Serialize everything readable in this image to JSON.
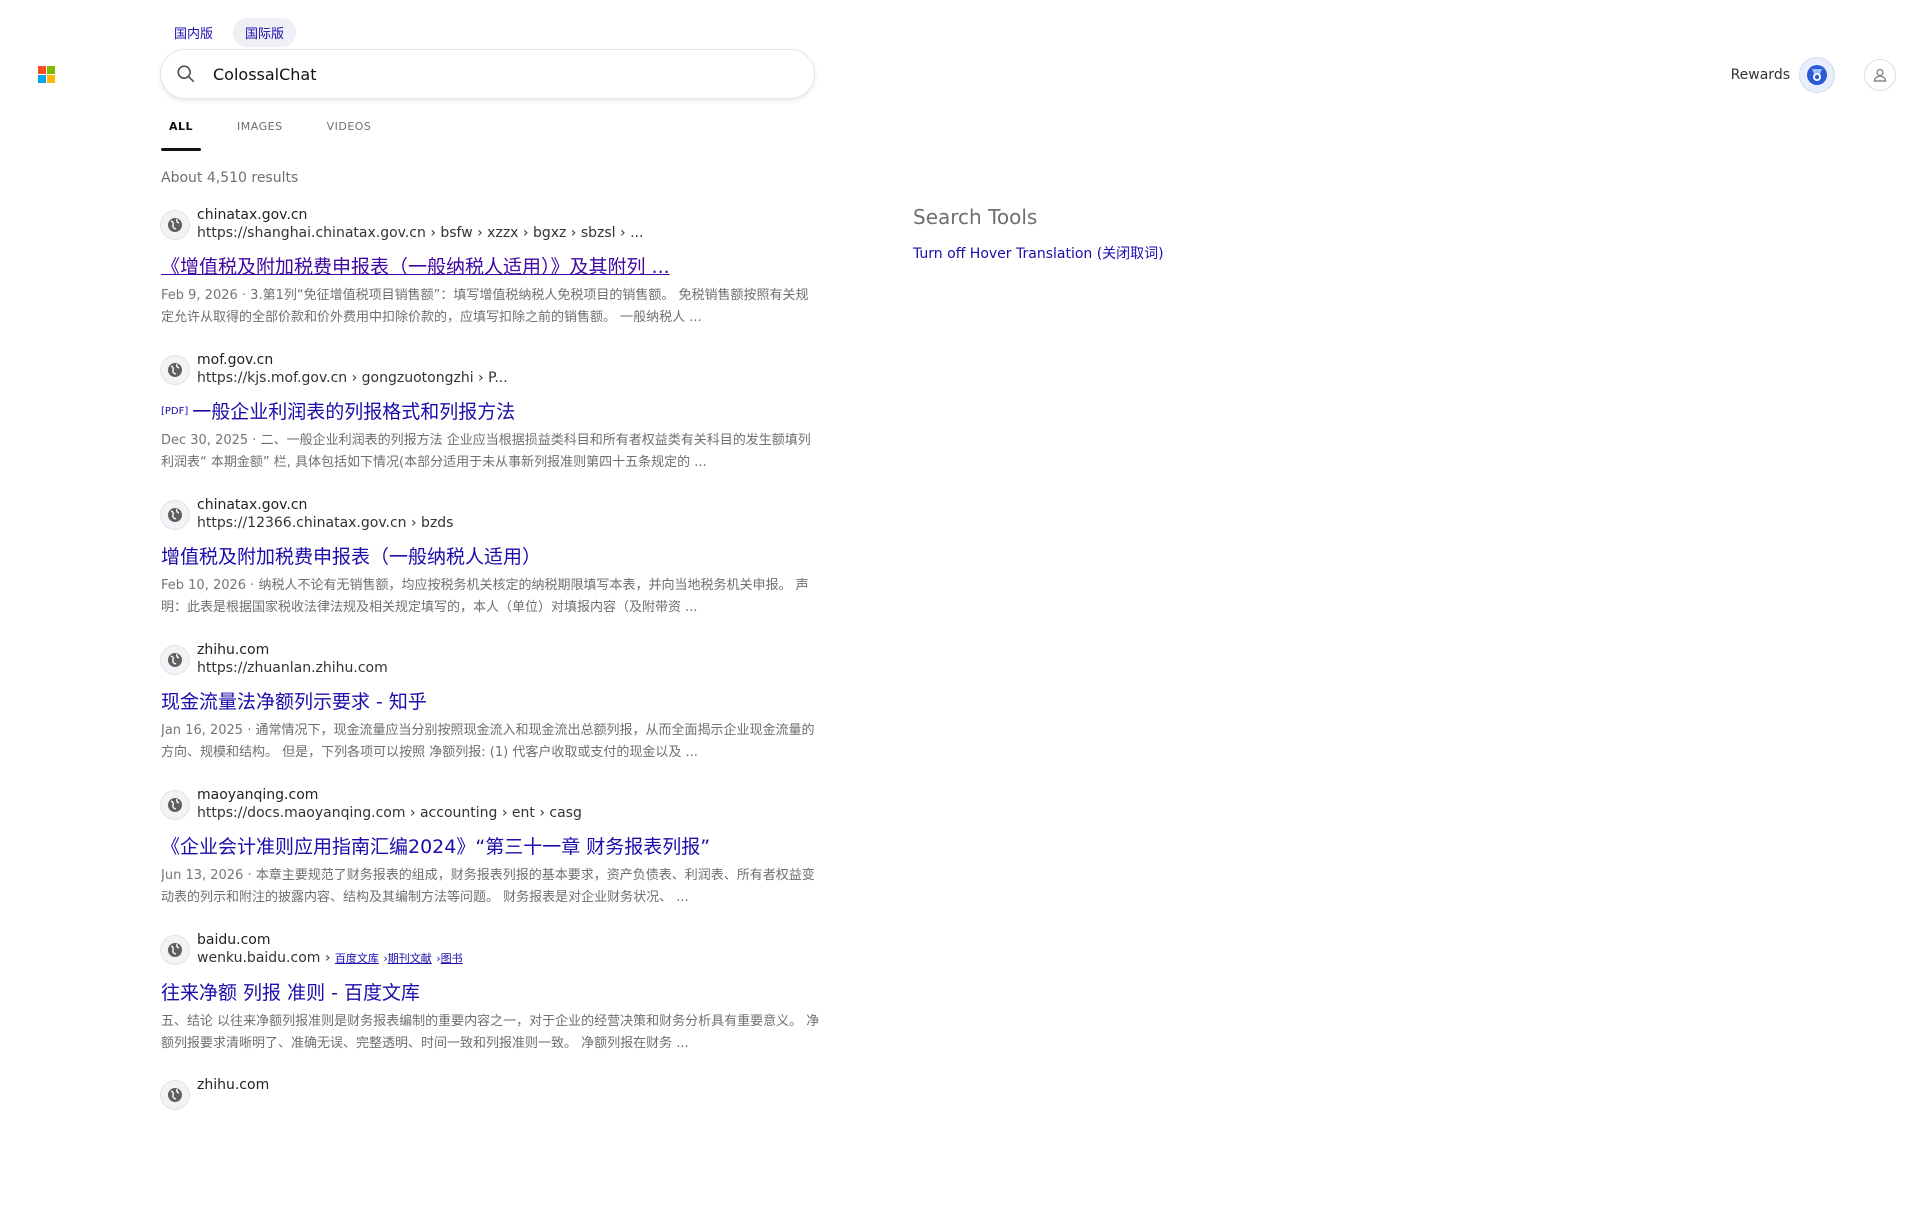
{
  "market_tabs": [
    "国内版",
    "国际版"
  ],
  "search": {
    "query": "ColossalChat"
  },
  "header": {
    "rewards_label": "Rewards"
  },
  "scope_tabs": [
    "ALL",
    "IMAGES",
    "VIDEOS"
  ],
  "result_count": "About 4,510 results",
  "sidebar": {
    "title": "Search Tools",
    "link": "Turn off Hover Translation (关闭取词)"
  },
  "results": [
    {
      "site": "chinatax.gov.cn",
      "url": "https://shanghai.chinatax.gov.cn › bsfw › xzzx › bgxz › sbzsl › ...",
      "title": "《增值税及附加税费申报表（一般纳税人适用）》及其附列 ...",
      "date": "Feb 9, 2026 · ",
      "snippet": "3.第1列“免征增值税项目销售额”：填写增值税纳税人免税项目的销售额。 免税销售额按照有关规定允许从取得的全部价款和价外费用中扣除价款的，应填写扣除之前的销售额。 一般纳税人 ..."
    },
    {
      "site": "mof.gov.cn",
      "url": "https://kjs.mof.gov.cn › gongzuotongzhi › P...",
      "pdf": "[PDF]",
      "title": "一般企业利润表的列报格式和列报方法",
      "date": "Dec 30, 2025 · ",
      "snippet": "二、一般企业利润表的列报方法 企业应当根据损益类科目和所有者权益类有关科目的发生额填列利润表“ 本期金额” 栏, 具体包括如下情况(本部分适用于未从事新列报准则第四十五条规定的 ..."
    },
    {
      "site": "chinatax.gov.cn",
      "url": "https://12366.chinatax.gov.cn › bzds",
      "title": "增值税及附加税费申报表（一般纳税人适用）",
      "date": "Feb 10, 2026 · ",
      "snippet": "纳税人不论有无销售额，均应按税务机关核定的纳税期限填写本表，并向当地税务机关申报。 声明：此表是根据国家税收法律法规及相关规定填写的，本人（单位）对填报内容（及附带资 ..."
    },
    {
      "site": "zhihu.com",
      "url": "https://zhuanlan.zhihu.com",
      "title": "现金流量法净额列示要求 - 知乎",
      "date": "Jan 16, 2025 · ",
      "snippet": "通常情况下，现金流量应当分别按照现金流入和现金流出总额列报，从而全面揭示企业现金流量的方向、规模和结构。 但是，下列各项可以按照 净额列报: (1) 代客户收取或支付的现金以及 ..."
    },
    {
      "site": "maoyanqing.com",
      "url": "https://docs.maoyanqing.com › accounting › ent › casg",
      "title": "《企业会计准则应用指南汇编2024》“第三十一章 财务报表列报”",
      "date": "Jun 13, 2026 · ",
      "snippet": "本章主要规范了财务报表的组成，财务报表列报的基本要求，资产负债表、利润表、所有者权益变动表的列示和附注的披露内容、结构及其编制方法等问题。 财务报表是对企业财务状况、 ..."
    },
    {
      "site": "baidu.com",
      "url": "wenku.baidu.com › ",
      "crumbs": [
        "百度文库",
        "期刊文献",
        "图书"
      ],
      "title": "往来净额 列报 准则 - 百度文库",
      "date": "",
      "snippet": "五、结论 以往来净额列报准则是财务报表编制的重要内容之一，对于企业的经营决策和财务分析具有重要意义。 净额列报要求清晰明了、准确无误、完整透明、时间一致和列报准则一致。 净额列报在财务 ..."
    },
    {
      "site": "zhihu.com",
      "url": "",
      "title": "",
      "date": "",
      "snippet": ""
    }
  ],
  "colors": {
    "link": "#1a0dab",
    "visited": "#4007a2",
    "muted": "#6f6f6f"
  },
  "icons": [
    "microsoft-logo-icon",
    "search-icon",
    "rewards-medal-icon",
    "user-icon",
    "globe-icon"
  ]
}
